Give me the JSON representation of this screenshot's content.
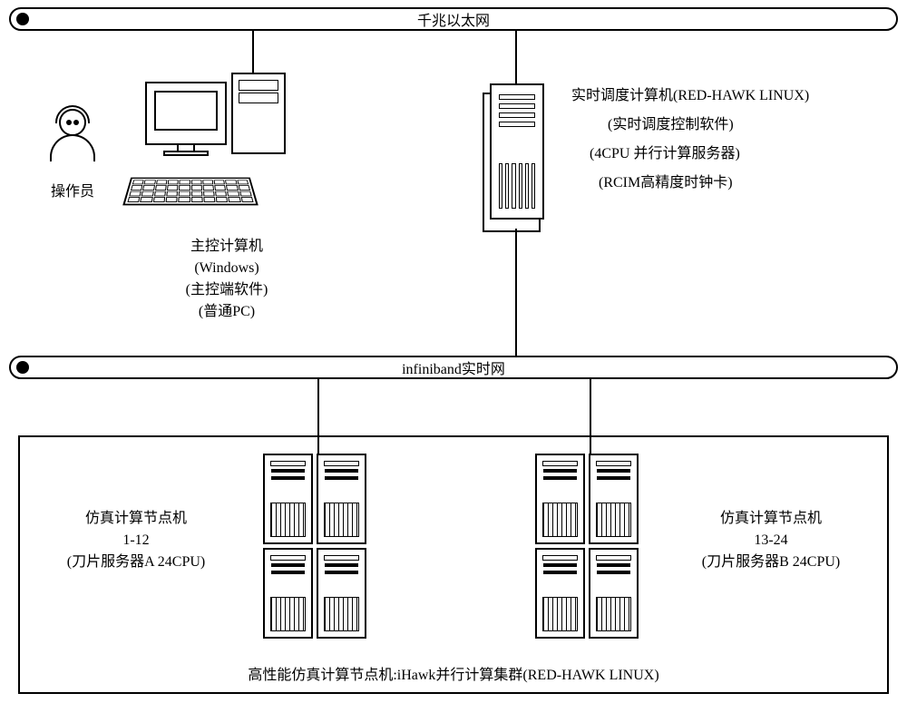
{
  "bus_top": "千兆以太网",
  "bus_mid": "infiniband实时网",
  "operator_label": "操作员",
  "pc": {
    "line1": "主控计算机",
    "line2": "(Windows)",
    "line3": "(主控端软件)",
    "line4": "(普通PC)"
  },
  "scheduler": {
    "line1": "实时调度计算机(RED-HAWK LINUX)",
    "line2": "(实时调度控制软件)",
    "line3": "(4CPU 并行计算服务器)",
    "line4": "(RCIM高精度时钟卡)"
  },
  "nodeA": {
    "line1": "仿真计算节点机",
    "line2": "1-12",
    "line3": "(刀片服务器A 24CPU)"
  },
  "nodeB": {
    "line1": "仿真计算节点机",
    "line2": "13-24",
    "line3": "(刀片服务器B 24CPU)"
  },
  "cluster_caption": "高性能仿真计算节点机:iHawk并行计算集群(RED-HAWK LINUX)"
}
